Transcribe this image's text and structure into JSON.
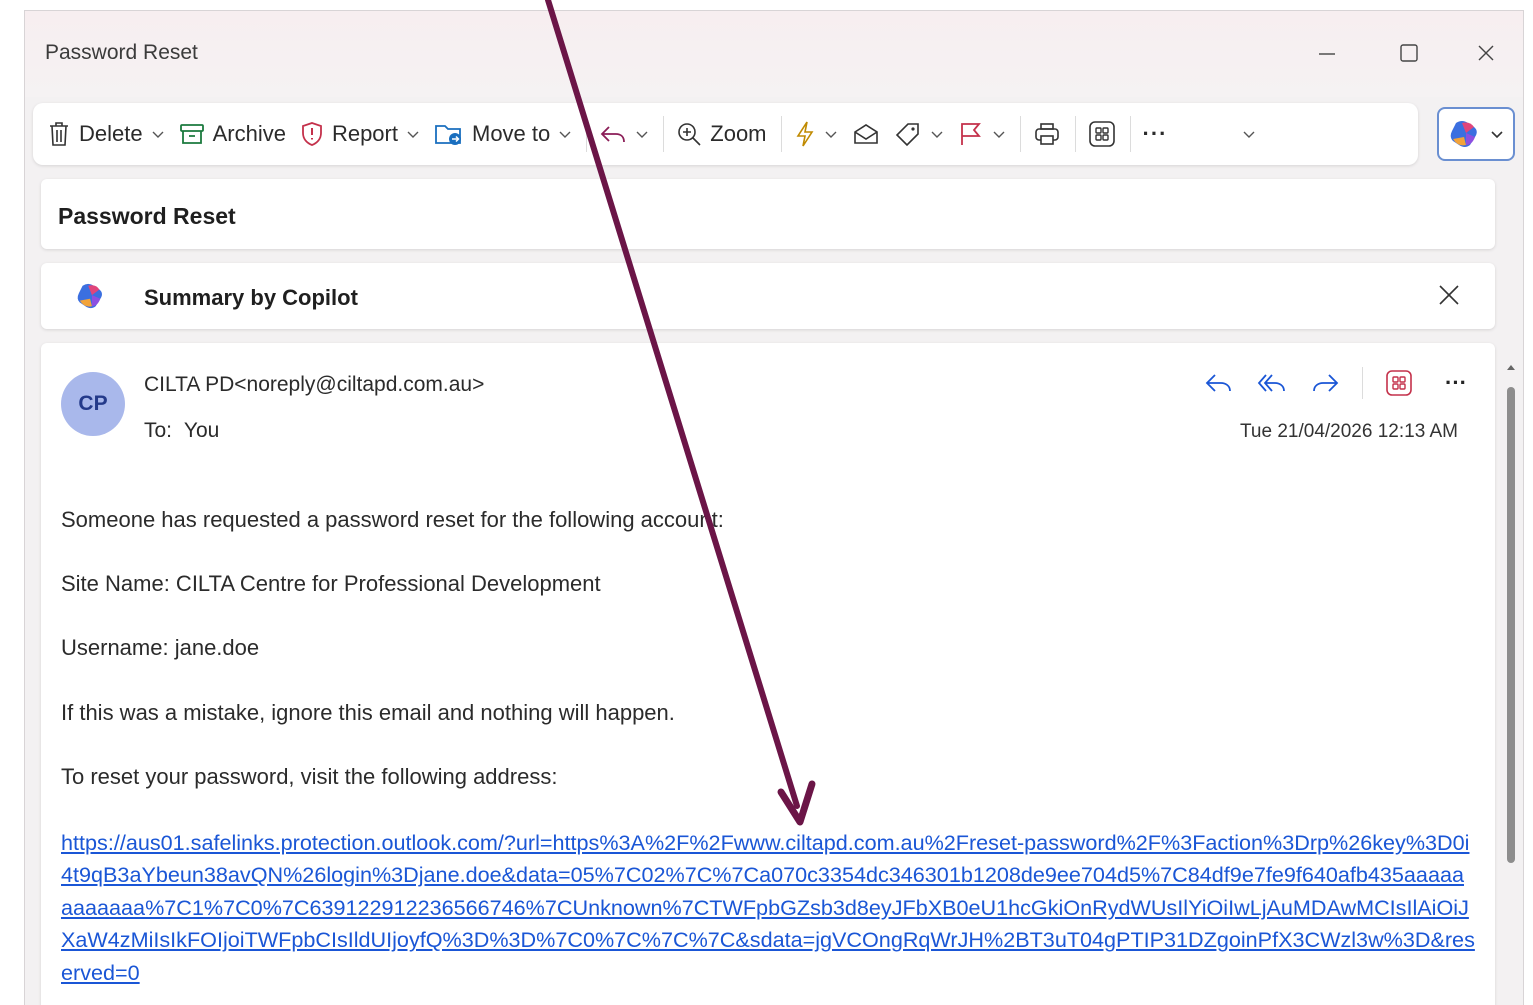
{
  "window": {
    "title": "Password Reset",
    "minimize_icon": "minimize-icon",
    "maximize_icon": "maximize-icon",
    "close_icon": "close-icon"
  },
  "toolbar": {
    "delete_label": "Delete",
    "archive_label": "Archive",
    "report_label": "Report",
    "move_label": "Move to",
    "zoom_label": "Zoom",
    "more_label": "···"
  },
  "subject": "Password Reset",
  "copilot_summary": {
    "label": "Summary by Copilot"
  },
  "message": {
    "avatar_initials": "CP",
    "sender": "CILTA PD<noreply@ciltapd.com.au>",
    "to_label": "To:",
    "to_value": "You",
    "date": "Tue 21/04/2026 12:13 AM",
    "more_label": "···",
    "body": [
      "Someone has requested a password reset for the following account:",
      "Site Name: CILTA Centre for Professional Development",
      "Username: jane.doe",
      "If this was a mistake, ignore this email and nothing will happen.",
      "To reset your password, visit the following address:"
    ],
    "link_text": "https://aus01.safelinks.protection.outlook.com/?url=https%3A%2F%2Fwww.ciltapd.com.au%2Freset-password%2F%3Faction%3Drp%26key%3D0i4t9qB3aYbeun38avQN%26login%3Djane.doe&data=05%7C02%7C%7Ca070c3354dc346301b1208de9ee704d5%7C84df9e7fe9f640afb435aaaaaaaaaaaa%7C1%7C0%7C639122912236566746%7CUnknown%7CTWFpbGZsb3d8eyJFbXB0eU1hcGkiOnRydWUsIlYiOiIwLjAuMDAwMCIsIlAiOiJXaW4zMiIsIkFOIjoiTWFpbCIsIldUIjoyfQ%3D%3D%7C0%7C%7C%7C&sdata=jgVCOngRqWrJH%2BT3uT04gPTIP31DZgoinPfX3CWzl3w%3D&reserved=0"
  },
  "colors": {
    "link": "#1a56d6",
    "arrow": "#6b1547",
    "action_icons": "#1a56d6",
    "apps_icon": "#c4314b",
    "avatar_bg": "#a9b8eb"
  }
}
